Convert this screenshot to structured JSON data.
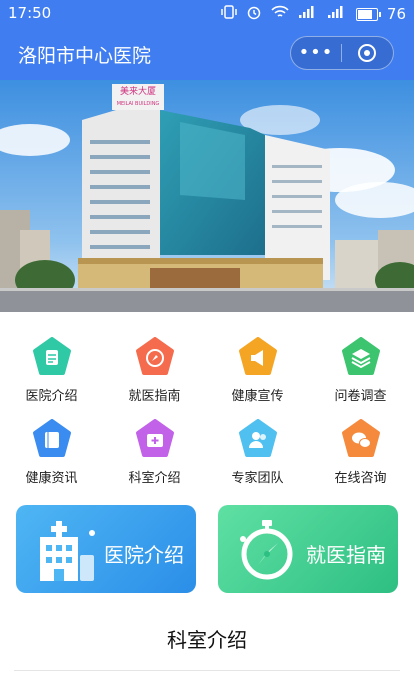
{
  "status": {
    "time": "17:50",
    "battery": "76"
  },
  "nav": {
    "title": "洛阳市中心医院",
    "more_icon": "more-dots-icon",
    "close_icon": "target-close-icon"
  },
  "banner": {
    "sign_main": "美来大厦",
    "sign_sub": "MEILAI BUILDING"
  },
  "grid": [
    {
      "label": "医院介绍",
      "color": "#2fc9a6",
      "icon": "document-icon"
    },
    {
      "label": "就医指南",
      "color": "#f56b4d",
      "icon": "compass-icon"
    },
    {
      "label": "健康宣传",
      "color": "#f5a524",
      "icon": "megaphone-icon"
    },
    {
      "label": "问卷调查",
      "color": "#3cc46f",
      "icon": "layers-icon"
    },
    {
      "label": "健康资讯",
      "color": "#3a8cf0",
      "icon": "book-icon"
    },
    {
      "label": "科室介绍",
      "color": "#c162e8",
      "icon": "medical-kit-icon"
    },
    {
      "label": "专家团队",
      "color": "#4fc0ef",
      "icon": "people-icon"
    },
    {
      "label": "在线咨询",
      "color": "#f58a3c",
      "icon": "chat-icon"
    }
  ],
  "cards": [
    {
      "label": "医院介绍",
      "from": "#4fb6f4",
      "to": "#2b8ee8",
      "icon": "hospital-building-icon"
    },
    {
      "label": "就医指南",
      "from": "#5fe0a3",
      "to": "#2ebf83",
      "icon": "compass-stopwatch-icon"
    }
  ],
  "section": {
    "title": "科室介绍"
  }
}
